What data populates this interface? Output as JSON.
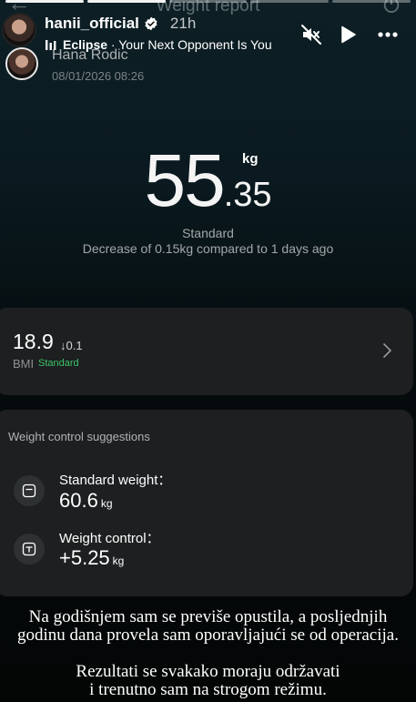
{
  "story": {
    "username": "hanii_official",
    "time_ago": "21h",
    "music_artist": "Eclipse",
    "music_title": "Your Next Opponent Is You",
    "progress_segments": 5,
    "progress_done": 2
  },
  "app": {
    "title": "Weight report",
    "profile_name": "Hana Rodic",
    "date": "08/01/2026 08:26"
  },
  "weight": {
    "integer": "55",
    "decimal": ".35",
    "unit": "kg",
    "status": "Standard",
    "change_text": "Decrease of 0.15kg compared to 1 days ago"
  },
  "bmi": {
    "value": "18.9",
    "delta": "0.1",
    "label": "BMI",
    "status": "Standard",
    "status_color": "#3cc46a"
  },
  "suggestions": {
    "title": "Weight control suggestions",
    "standard_label": "Standard weight：",
    "standard_value": "60.6",
    "control_label": "Weight control：",
    "control_value": "+5.25",
    "unit": "kg"
  },
  "caption": {
    "line1": "Na godišnjem sam se previše  opustila, a posljednjih",
    "line2": "godinu dana provela sam oporavljajući se od operacija.",
    "line3": "Rezultati se svakako moraju održavati",
    "line4": "i trenutno sam na strogom režimu."
  }
}
